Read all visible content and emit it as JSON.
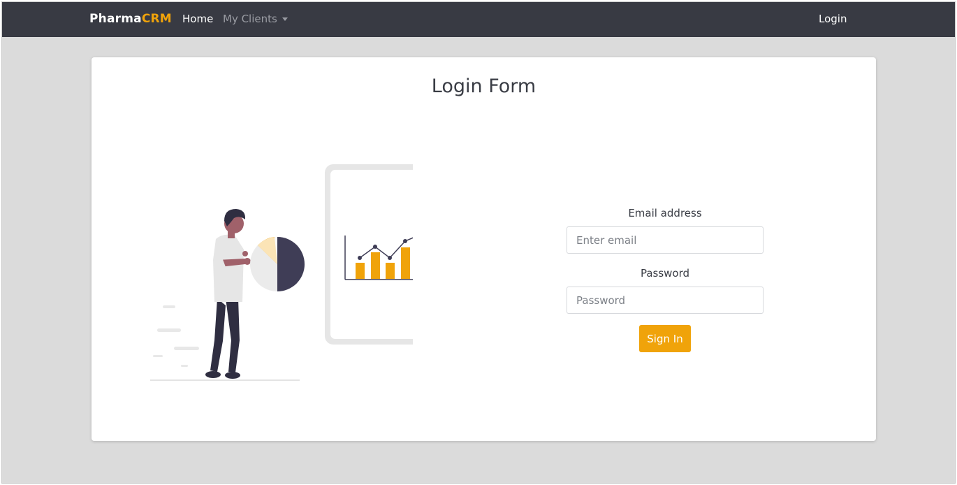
{
  "navbar": {
    "brand_prefix": "Pharma",
    "brand_suffix": "CRM",
    "home_label": "Home",
    "clients_label": "My Clients",
    "login_label": "Login"
  },
  "card": {
    "title": "Login Form"
  },
  "form": {
    "email_label": "Email address",
    "email_placeholder": "Enter email",
    "email_value": "",
    "password_label": "Password",
    "password_placeholder": "Password",
    "password_value": "",
    "signin_label": "Sign In"
  },
  "colors": {
    "navbar_bg": "#383a43",
    "accent": "#f0a30a",
    "page_bg": "#dbdbdb",
    "card_bg": "#ffffff"
  },
  "icons": {
    "illustration": "person-with-pie-chart-and-tablet-bar-chart-illustration",
    "dropdown_caret": "chevron-down-icon"
  }
}
